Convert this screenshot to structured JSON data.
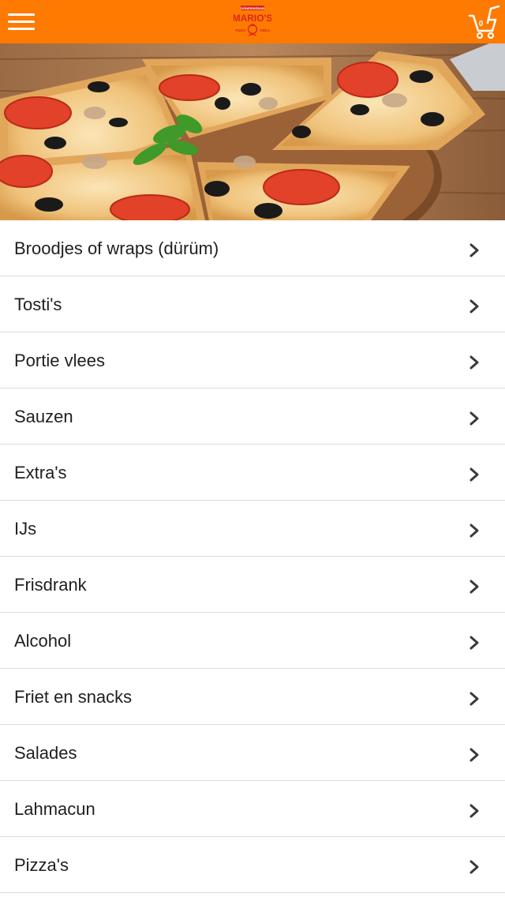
{
  "header": {
    "menu_icon": "hamburger-menu-icon",
    "logo_text": "MARIO'S",
    "logo_top_text": "DÖNER/KEBAB",
    "logo_left_text": "PIZZA",
    "logo_right_text": "GRILL",
    "cart_icon": "shopping-cart-icon",
    "cart_count": "0"
  },
  "hero": {
    "image": "pizza-slices-photo"
  },
  "categories": [
    {
      "label": "Broodjes of wraps (dürüm)"
    },
    {
      "label": "Tosti's"
    },
    {
      "label": "Portie vlees"
    },
    {
      "label": "Sauzen"
    },
    {
      "label": "Extra's"
    },
    {
      "label": "IJs"
    },
    {
      "label": "Frisdrank"
    },
    {
      "label": "Alcohol"
    },
    {
      "label": "Friet en snacks"
    },
    {
      "label": "Salades"
    },
    {
      "label": "Lahmacun"
    },
    {
      "label": "Pizza's"
    }
  ],
  "colors": {
    "header_bg": "#ff7a00",
    "logo_red": "#d9261c",
    "text": "#1f1f1f",
    "divider": "#dcdcdc",
    "chevron": "#3a3a3a"
  }
}
